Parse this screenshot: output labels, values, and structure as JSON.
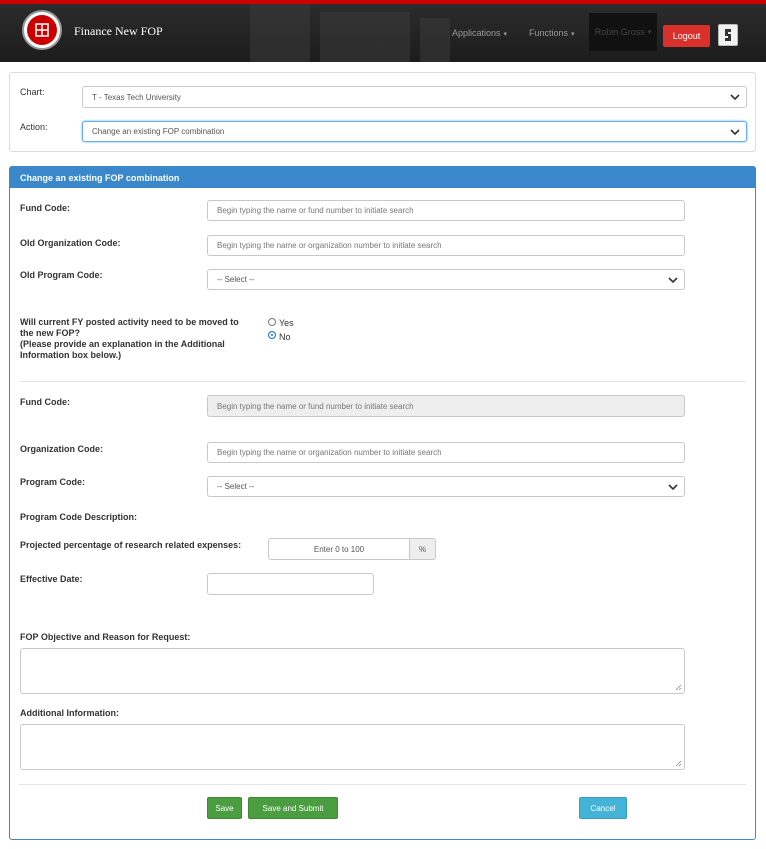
{
  "header": {
    "app_title": "Finance New FOP",
    "nav": {
      "applications": "Applications",
      "functions": "Functions",
      "user_name": "Robin Gross",
      "logout": "Logout"
    }
  },
  "filters": {
    "chart_label": "Chart:",
    "chart_value": "T - Texas Tech University",
    "action_label": "Action:",
    "action_value": "Change an existing FOP combination"
  },
  "form": {
    "title": "Change an existing FOP combination",
    "fund_code_label": "Fund Code:",
    "fund_code_placeholder": "Begin typing the name or fund number to initiate search",
    "old_org_label": "Old Organization Code:",
    "old_org_placeholder": "Begin typing the name or organization number to initiate search",
    "old_program_label": "Old Program Code:",
    "old_program_value": "-- Select --",
    "move_question_line1": "Will current FY posted activity need to be moved to",
    "move_question_line2": "the new FOP?",
    "move_question_line3": "(Please provide an explanation in the Additional",
    "move_question_line4": "Information box below.)",
    "option_yes": "Yes",
    "option_no": "No",
    "selected_option": "No",
    "new_fund_code_label": "Fund Code:",
    "new_fund_code_placeholder": "Begin typing the name or fund number to initiate search",
    "org_code_label": "Organization Code:",
    "org_code_placeholder": "Begin typing the name or organization number to initiate search",
    "program_code_label": "Program Code:",
    "program_code_value": "-- Select --",
    "program_desc_label": "Program Code Description:",
    "research_label": "Projected percentage of research related expenses:",
    "research_placeholder": "Enter 0 to 100",
    "percent_symbol": "%",
    "effective_date_label": "Effective Date:",
    "effective_date_value": "",
    "objective_label": "FOP Objective and Reason for Request:",
    "additional_label": "Additional Information:"
  },
  "buttons": {
    "save": "Save",
    "save_submit": "Save and Submit",
    "cancel": "Cancel"
  },
  "colors": {
    "nav_bg": "#1c1c1c",
    "brand_red": "#cc0000",
    "panel_header_blue": "#3a87cc",
    "save_green": "#4a9d40",
    "cancel_cyan": "#45b3d8"
  },
  "icons": {
    "logo": "university-seal-icon",
    "tools": "settings-icon"
  }
}
